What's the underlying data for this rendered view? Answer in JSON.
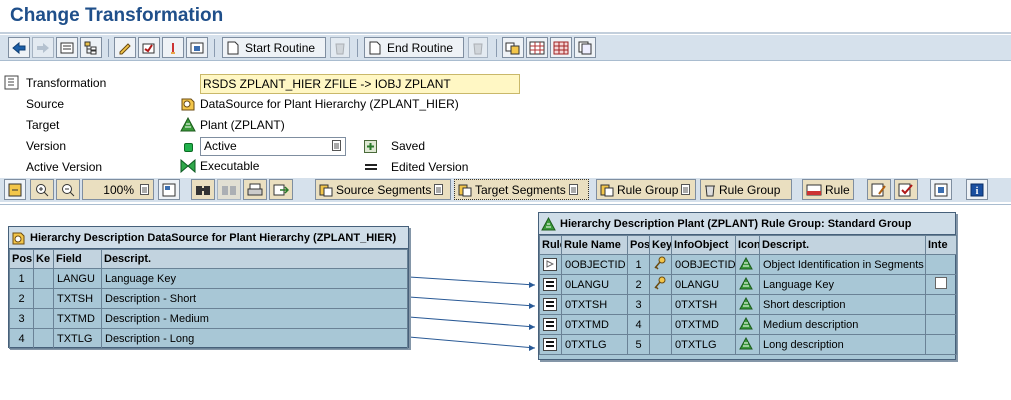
{
  "window": {
    "title": "Change Transformation"
  },
  "toolbar": {
    "start_routine": "Start Routine",
    "end_routine": "End Routine"
  },
  "header": {
    "transformation_label": "Transformation",
    "transformation_value": "RSDS ZPLANT_HIER ZFILE -> IOBJ ZPLANT",
    "source_label": "Source",
    "source_value": "DataSource for Plant Hierarchy (ZPLANT_HIER)",
    "target_label": "Target",
    "target_value": "Plant (ZPLANT)",
    "version_label": "Version",
    "version_value": "Active",
    "active_version_label": "Active Version",
    "active_version_value": "Executable",
    "legend_saved": "Saved",
    "legend_edited": "Edited Version"
  },
  "graph_toolbar": {
    "zoom": "100%",
    "source_segments": "Source Segments",
    "target_segments": "Target Segments",
    "rule_group_1": "Rule Group",
    "rule_group_2": "Rule Group",
    "rule": "Rule"
  },
  "source_panel": {
    "title": "Hierarchy Description DataSource for Plant Hierarchy (ZPLANT_HIER)",
    "columns": [
      "Pos",
      "Ke",
      "Field",
      "Descript."
    ],
    "rows": [
      {
        "pos": "1",
        "field": "LANGU",
        "desc": "Language Key"
      },
      {
        "pos": "2",
        "field": "TXTSH",
        "desc": "Description - Short"
      },
      {
        "pos": "3",
        "field": "TXTMD",
        "desc": "Description - Medium"
      },
      {
        "pos": "4",
        "field": "TXTLG",
        "desc": "Description - Long"
      }
    ]
  },
  "target_panel": {
    "title": "Hierarchy Description Plant (ZPLANT) Rule Group: Standard Group",
    "columns": [
      "Rule",
      "Rule Name",
      "Pos",
      "Key",
      "InfoObject",
      "Icon",
      "Descript.",
      "Inte"
    ],
    "rows": [
      {
        "rule_name": "0OBJECTID",
        "pos": "1",
        "infoobject": "0OBJECTID",
        "desc": "Object Identification in Segments"
      },
      {
        "rule_name": "0LANGU",
        "pos": "2",
        "infoobject": "0LANGU",
        "desc": "Language Key"
      },
      {
        "rule_name": "0TXTSH",
        "pos": "3",
        "infoobject": "0TXTSH",
        "desc": "Short description"
      },
      {
        "rule_name": "0TXTMD",
        "pos": "4",
        "infoobject": "0TXTMD",
        "desc": "Medium description"
      },
      {
        "rule_name": "0TXTLG",
        "pos": "5",
        "infoobject": "0TXTLG",
        "desc": "Long description"
      }
    ]
  },
  "colors": {
    "title": "#1f4f8a",
    "toolbar_bg": "#d6e1ec",
    "panel_bg": "#a8c7d6",
    "field_bg": "#fff7c4"
  }
}
